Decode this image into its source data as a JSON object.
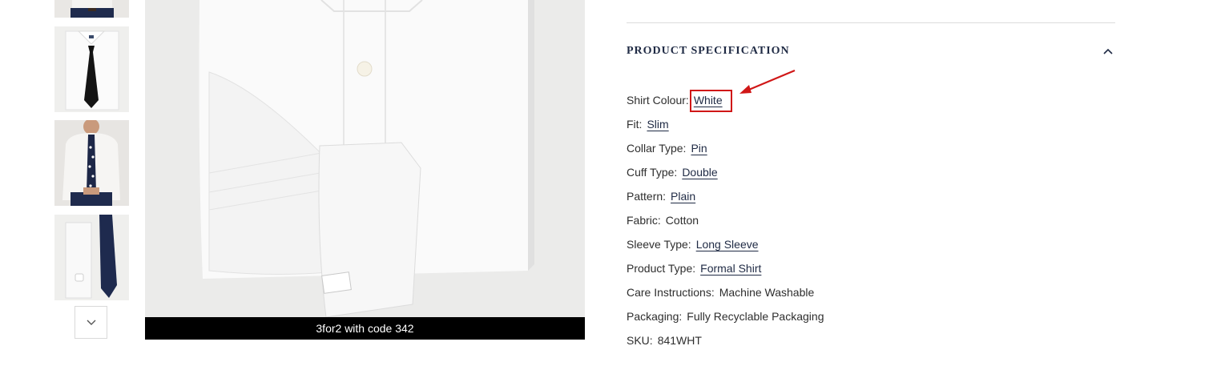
{
  "gallery": {
    "thumbnails": [
      {
        "name": "thumbnail-model-bottom"
      },
      {
        "name": "thumbnail-folded-shirt-black-tie"
      },
      {
        "name": "thumbnail-model-navy-spot-tie"
      },
      {
        "name": "thumbnail-cuff-navy-tie"
      }
    ],
    "scroll_icon": "chevron-down-icon"
  },
  "main_image": {
    "promo_text": "3for2 with code 342"
  },
  "spec": {
    "heading": "PRODUCT SPECIFICATION",
    "toggle_icon": "chevron-up-icon",
    "items": [
      {
        "label": "Shirt Colour:",
        "value": "White",
        "link": true
      },
      {
        "label": "Fit:",
        "value": "Slim",
        "link": true
      },
      {
        "label": "Collar Type:",
        "value": "Pin",
        "link": true
      },
      {
        "label": "Cuff Type:",
        "value": "Double",
        "link": true
      },
      {
        "label": "Pattern:",
        "value": "Plain",
        "link": true
      },
      {
        "label": "Fabric:",
        "value": "Cotton",
        "link": false
      },
      {
        "label": "Sleeve Type:",
        "value": "Long Sleeve",
        "link": true
      },
      {
        "label": "Product Type:",
        "value": "Formal Shirt",
        "link": true
      },
      {
        "label": "Care Instructions:",
        "value": "Machine Washable",
        "link": false
      },
      {
        "label": "Packaging:",
        "value": "Fully Recyclable Packaging",
        "link": false
      },
      {
        "label": "SKU:",
        "value": "841WHT",
        "link": false
      }
    ]
  },
  "annotation": {
    "highlight_color": "#d01717",
    "target": "Shirt Colour value"
  }
}
